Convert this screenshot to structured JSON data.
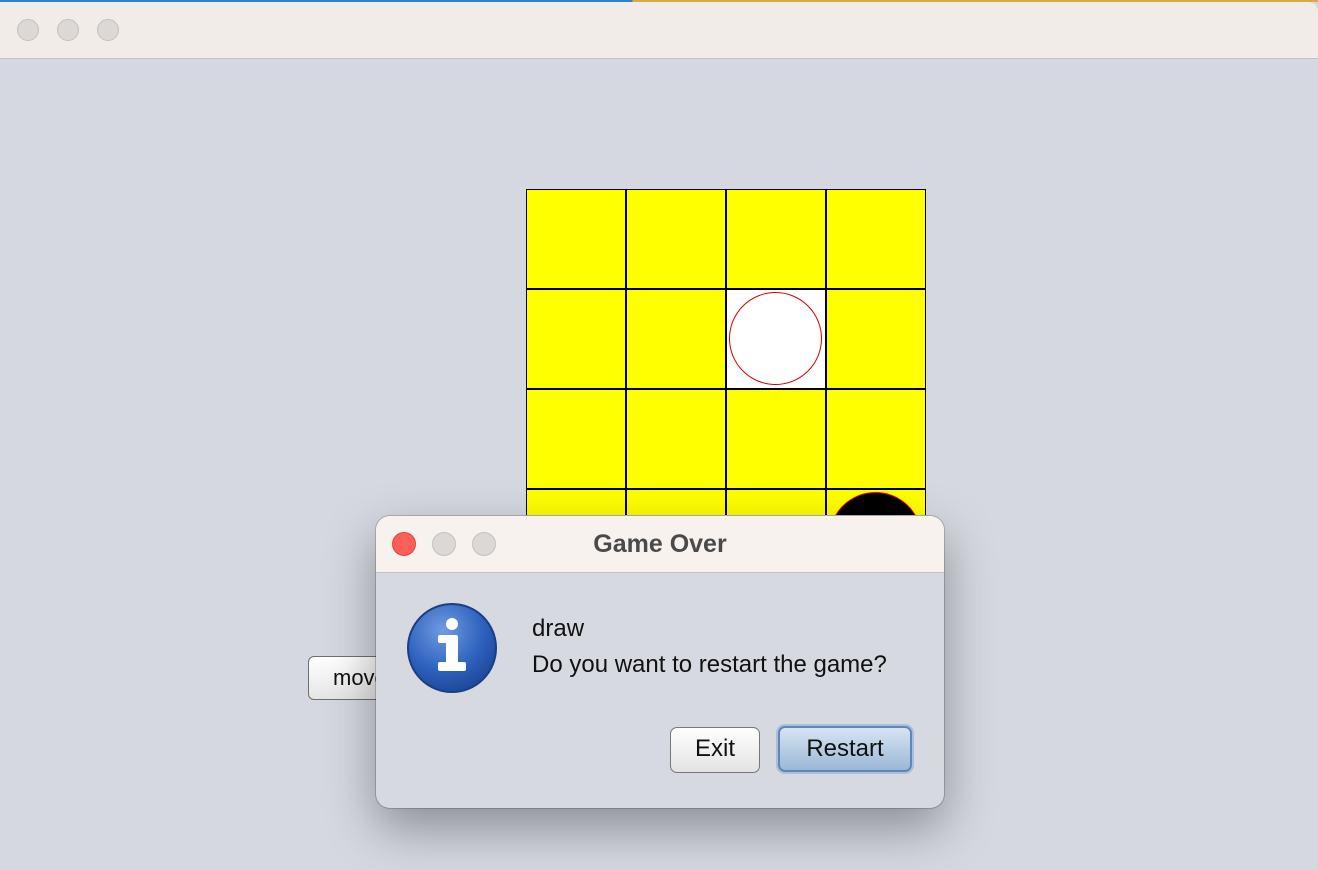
{
  "window": {
    "title": "",
    "traffic_lights": [
      "close-icon",
      "minimize-icon",
      "zoom-icon"
    ]
  },
  "board": {
    "rows": 4,
    "cols": 4,
    "cell_color": "#ffff00",
    "pieces": [
      {
        "row": 1,
        "col": 2,
        "color": "white"
      },
      {
        "row": 3,
        "col": 3,
        "color": "black"
      }
    ]
  },
  "move_button": {
    "label": "move"
  },
  "dialog": {
    "title": "Game Over",
    "icon": "info-icon",
    "message_line1": "draw",
    "message_line2": "Do you want to restart the game?",
    "buttons": {
      "exit_label": "Exit",
      "restart_label": "Restart"
    },
    "colors": {
      "close": "#ff5f57",
      "info_blue": "#2a5fb8"
    }
  }
}
